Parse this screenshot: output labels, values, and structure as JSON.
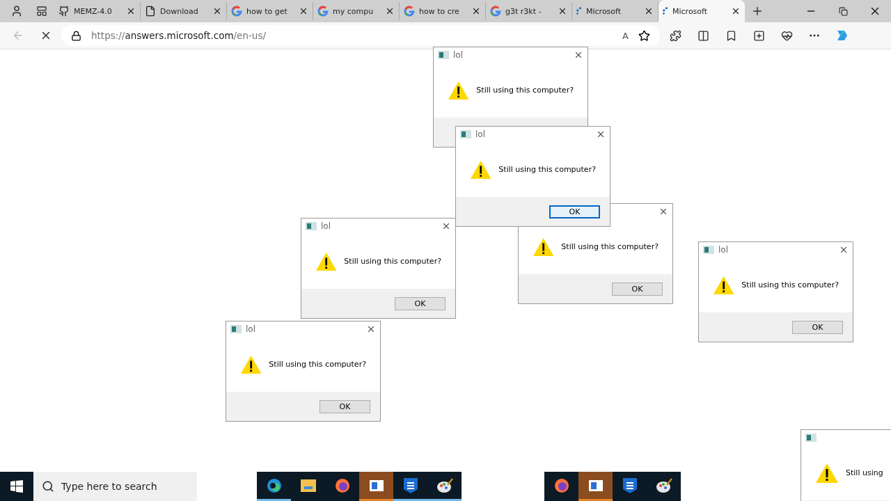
{
  "tabs": [
    {
      "label": "MEMZ-4.0",
      "kind": "github",
      "selected": false
    },
    {
      "label": "Download",
      "kind": "file",
      "selected": false
    },
    {
      "label": "how to get",
      "kind": "google",
      "selected": false
    },
    {
      "label": "my compu",
      "kind": "google",
      "selected": false
    },
    {
      "label": "how to cre",
      "kind": "google",
      "selected": false
    },
    {
      "label": "g3t r3kt -",
      "kind": "google",
      "selected": false
    },
    {
      "label": "Microsoft",
      "kind": "loading",
      "selected": false
    },
    {
      "label": "Microsoft",
      "kind": "loading",
      "selected": true
    }
  ],
  "address": {
    "scheme": "https://",
    "host": "answers.microsoft.com",
    "path": "/en-us/",
    "loading": true,
    "read_aloud": "A"
  },
  "dialogs": [
    {
      "title": "lol",
      "message": "Still using this computer?"
    },
    {
      "message": "Still using this computer?",
      "ok": "OK",
      "focused": false
    },
    {
      "title": "lol",
      "message": "Still using this computer?",
      "ok": "OK",
      "focused": true
    },
    {
      "title": "lol",
      "message": "Still using this computer?",
      "ok": "OK",
      "focused": false
    },
    {
      "title": "lol",
      "message": "Still using this computer?",
      "ok": "OK",
      "focused": false
    },
    {
      "title": "lol",
      "message": "Still using this computer?",
      "ok": "OK",
      "focused": false
    },
    {
      "message": "Still using"
    }
  ],
  "taskbar": {
    "search_placeholder": "Type here to search",
    "apps": [
      {
        "kind": "edge",
        "running": true
      },
      {
        "kind": "folder",
        "running": false
      },
      {
        "kind": "firefox",
        "running": false
      },
      {
        "kind": "window",
        "running": true
      },
      {
        "kind": "shield",
        "running": true
      },
      {
        "kind": "paint",
        "running": true
      }
    ],
    "ghost_apps": [
      {
        "kind": "firefox",
        "running": false
      },
      {
        "kind": "window",
        "running": true
      },
      {
        "kind": "shield",
        "running": false
      },
      {
        "kind": "paint",
        "running": false
      }
    ]
  }
}
